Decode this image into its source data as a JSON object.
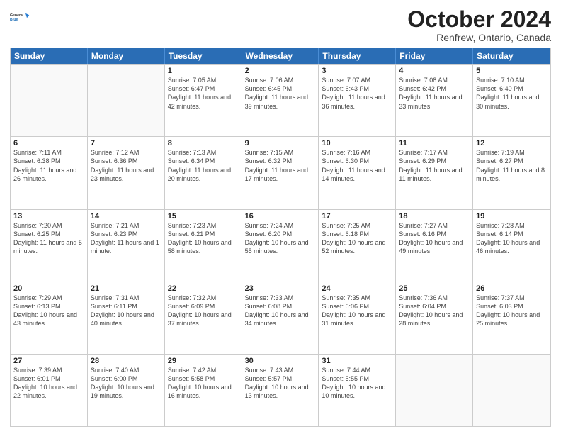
{
  "header": {
    "logo_line1": "General",
    "logo_line2": "Blue",
    "month": "October 2024",
    "location": "Renfrew, Ontario, Canada"
  },
  "days_of_week": [
    "Sunday",
    "Monday",
    "Tuesday",
    "Wednesday",
    "Thursday",
    "Friday",
    "Saturday"
  ],
  "weeks": [
    [
      {
        "day": "",
        "sunrise": "",
        "sunset": "",
        "daylight": ""
      },
      {
        "day": "",
        "sunrise": "",
        "sunset": "",
        "daylight": ""
      },
      {
        "day": "1",
        "sunrise": "Sunrise: 7:05 AM",
        "sunset": "Sunset: 6:47 PM",
        "daylight": "Daylight: 11 hours and 42 minutes."
      },
      {
        "day": "2",
        "sunrise": "Sunrise: 7:06 AM",
        "sunset": "Sunset: 6:45 PM",
        "daylight": "Daylight: 11 hours and 39 minutes."
      },
      {
        "day": "3",
        "sunrise": "Sunrise: 7:07 AM",
        "sunset": "Sunset: 6:43 PM",
        "daylight": "Daylight: 11 hours and 36 minutes."
      },
      {
        "day": "4",
        "sunrise": "Sunrise: 7:08 AM",
        "sunset": "Sunset: 6:42 PM",
        "daylight": "Daylight: 11 hours and 33 minutes."
      },
      {
        "day": "5",
        "sunrise": "Sunrise: 7:10 AM",
        "sunset": "Sunset: 6:40 PM",
        "daylight": "Daylight: 11 hours and 30 minutes."
      }
    ],
    [
      {
        "day": "6",
        "sunrise": "Sunrise: 7:11 AM",
        "sunset": "Sunset: 6:38 PM",
        "daylight": "Daylight: 11 hours and 26 minutes."
      },
      {
        "day": "7",
        "sunrise": "Sunrise: 7:12 AM",
        "sunset": "Sunset: 6:36 PM",
        "daylight": "Daylight: 11 hours and 23 minutes."
      },
      {
        "day": "8",
        "sunrise": "Sunrise: 7:13 AM",
        "sunset": "Sunset: 6:34 PM",
        "daylight": "Daylight: 11 hours and 20 minutes."
      },
      {
        "day": "9",
        "sunrise": "Sunrise: 7:15 AM",
        "sunset": "Sunset: 6:32 PM",
        "daylight": "Daylight: 11 hours and 17 minutes."
      },
      {
        "day": "10",
        "sunrise": "Sunrise: 7:16 AM",
        "sunset": "Sunset: 6:30 PM",
        "daylight": "Daylight: 11 hours and 14 minutes."
      },
      {
        "day": "11",
        "sunrise": "Sunrise: 7:17 AM",
        "sunset": "Sunset: 6:29 PM",
        "daylight": "Daylight: 11 hours and 11 minutes."
      },
      {
        "day": "12",
        "sunrise": "Sunrise: 7:19 AM",
        "sunset": "Sunset: 6:27 PM",
        "daylight": "Daylight: 11 hours and 8 minutes."
      }
    ],
    [
      {
        "day": "13",
        "sunrise": "Sunrise: 7:20 AM",
        "sunset": "Sunset: 6:25 PM",
        "daylight": "Daylight: 11 hours and 5 minutes."
      },
      {
        "day": "14",
        "sunrise": "Sunrise: 7:21 AM",
        "sunset": "Sunset: 6:23 PM",
        "daylight": "Daylight: 11 hours and 1 minute."
      },
      {
        "day": "15",
        "sunrise": "Sunrise: 7:23 AM",
        "sunset": "Sunset: 6:21 PM",
        "daylight": "Daylight: 10 hours and 58 minutes."
      },
      {
        "day": "16",
        "sunrise": "Sunrise: 7:24 AM",
        "sunset": "Sunset: 6:20 PM",
        "daylight": "Daylight: 10 hours and 55 minutes."
      },
      {
        "day": "17",
        "sunrise": "Sunrise: 7:25 AM",
        "sunset": "Sunset: 6:18 PM",
        "daylight": "Daylight: 10 hours and 52 minutes."
      },
      {
        "day": "18",
        "sunrise": "Sunrise: 7:27 AM",
        "sunset": "Sunset: 6:16 PM",
        "daylight": "Daylight: 10 hours and 49 minutes."
      },
      {
        "day": "19",
        "sunrise": "Sunrise: 7:28 AM",
        "sunset": "Sunset: 6:14 PM",
        "daylight": "Daylight: 10 hours and 46 minutes."
      }
    ],
    [
      {
        "day": "20",
        "sunrise": "Sunrise: 7:29 AM",
        "sunset": "Sunset: 6:13 PM",
        "daylight": "Daylight: 10 hours and 43 minutes."
      },
      {
        "day": "21",
        "sunrise": "Sunrise: 7:31 AM",
        "sunset": "Sunset: 6:11 PM",
        "daylight": "Daylight: 10 hours and 40 minutes."
      },
      {
        "day": "22",
        "sunrise": "Sunrise: 7:32 AM",
        "sunset": "Sunset: 6:09 PM",
        "daylight": "Daylight: 10 hours and 37 minutes."
      },
      {
        "day": "23",
        "sunrise": "Sunrise: 7:33 AM",
        "sunset": "Sunset: 6:08 PM",
        "daylight": "Daylight: 10 hours and 34 minutes."
      },
      {
        "day": "24",
        "sunrise": "Sunrise: 7:35 AM",
        "sunset": "Sunset: 6:06 PM",
        "daylight": "Daylight: 10 hours and 31 minutes."
      },
      {
        "day": "25",
        "sunrise": "Sunrise: 7:36 AM",
        "sunset": "Sunset: 6:04 PM",
        "daylight": "Daylight: 10 hours and 28 minutes."
      },
      {
        "day": "26",
        "sunrise": "Sunrise: 7:37 AM",
        "sunset": "Sunset: 6:03 PM",
        "daylight": "Daylight: 10 hours and 25 minutes."
      }
    ],
    [
      {
        "day": "27",
        "sunrise": "Sunrise: 7:39 AM",
        "sunset": "Sunset: 6:01 PM",
        "daylight": "Daylight: 10 hours and 22 minutes."
      },
      {
        "day": "28",
        "sunrise": "Sunrise: 7:40 AM",
        "sunset": "Sunset: 6:00 PM",
        "daylight": "Daylight: 10 hours and 19 minutes."
      },
      {
        "day": "29",
        "sunrise": "Sunrise: 7:42 AM",
        "sunset": "Sunset: 5:58 PM",
        "daylight": "Daylight: 10 hours and 16 minutes."
      },
      {
        "day": "30",
        "sunrise": "Sunrise: 7:43 AM",
        "sunset": "Sunset: 5:57 PM",
        "daylight": "Daylight: 10 hours and 13 minutes."
      },
      {
        "day": "31",
        "sunrise": "Sunrise: 7:44 AM",
        "sunset": "Sunset: 5:55 PM",
        "daylight": "Daylight: 10 hours and 10 minutes."
      },
      {
        "day": "",
        "sunrise": "",
        "sunset": "",
        "daylight": ""
      },
      {
        "day": "",
        "sunrise": "",
        "sunset": "",
        "daylight": ""
      }
    ]
  ]
}
